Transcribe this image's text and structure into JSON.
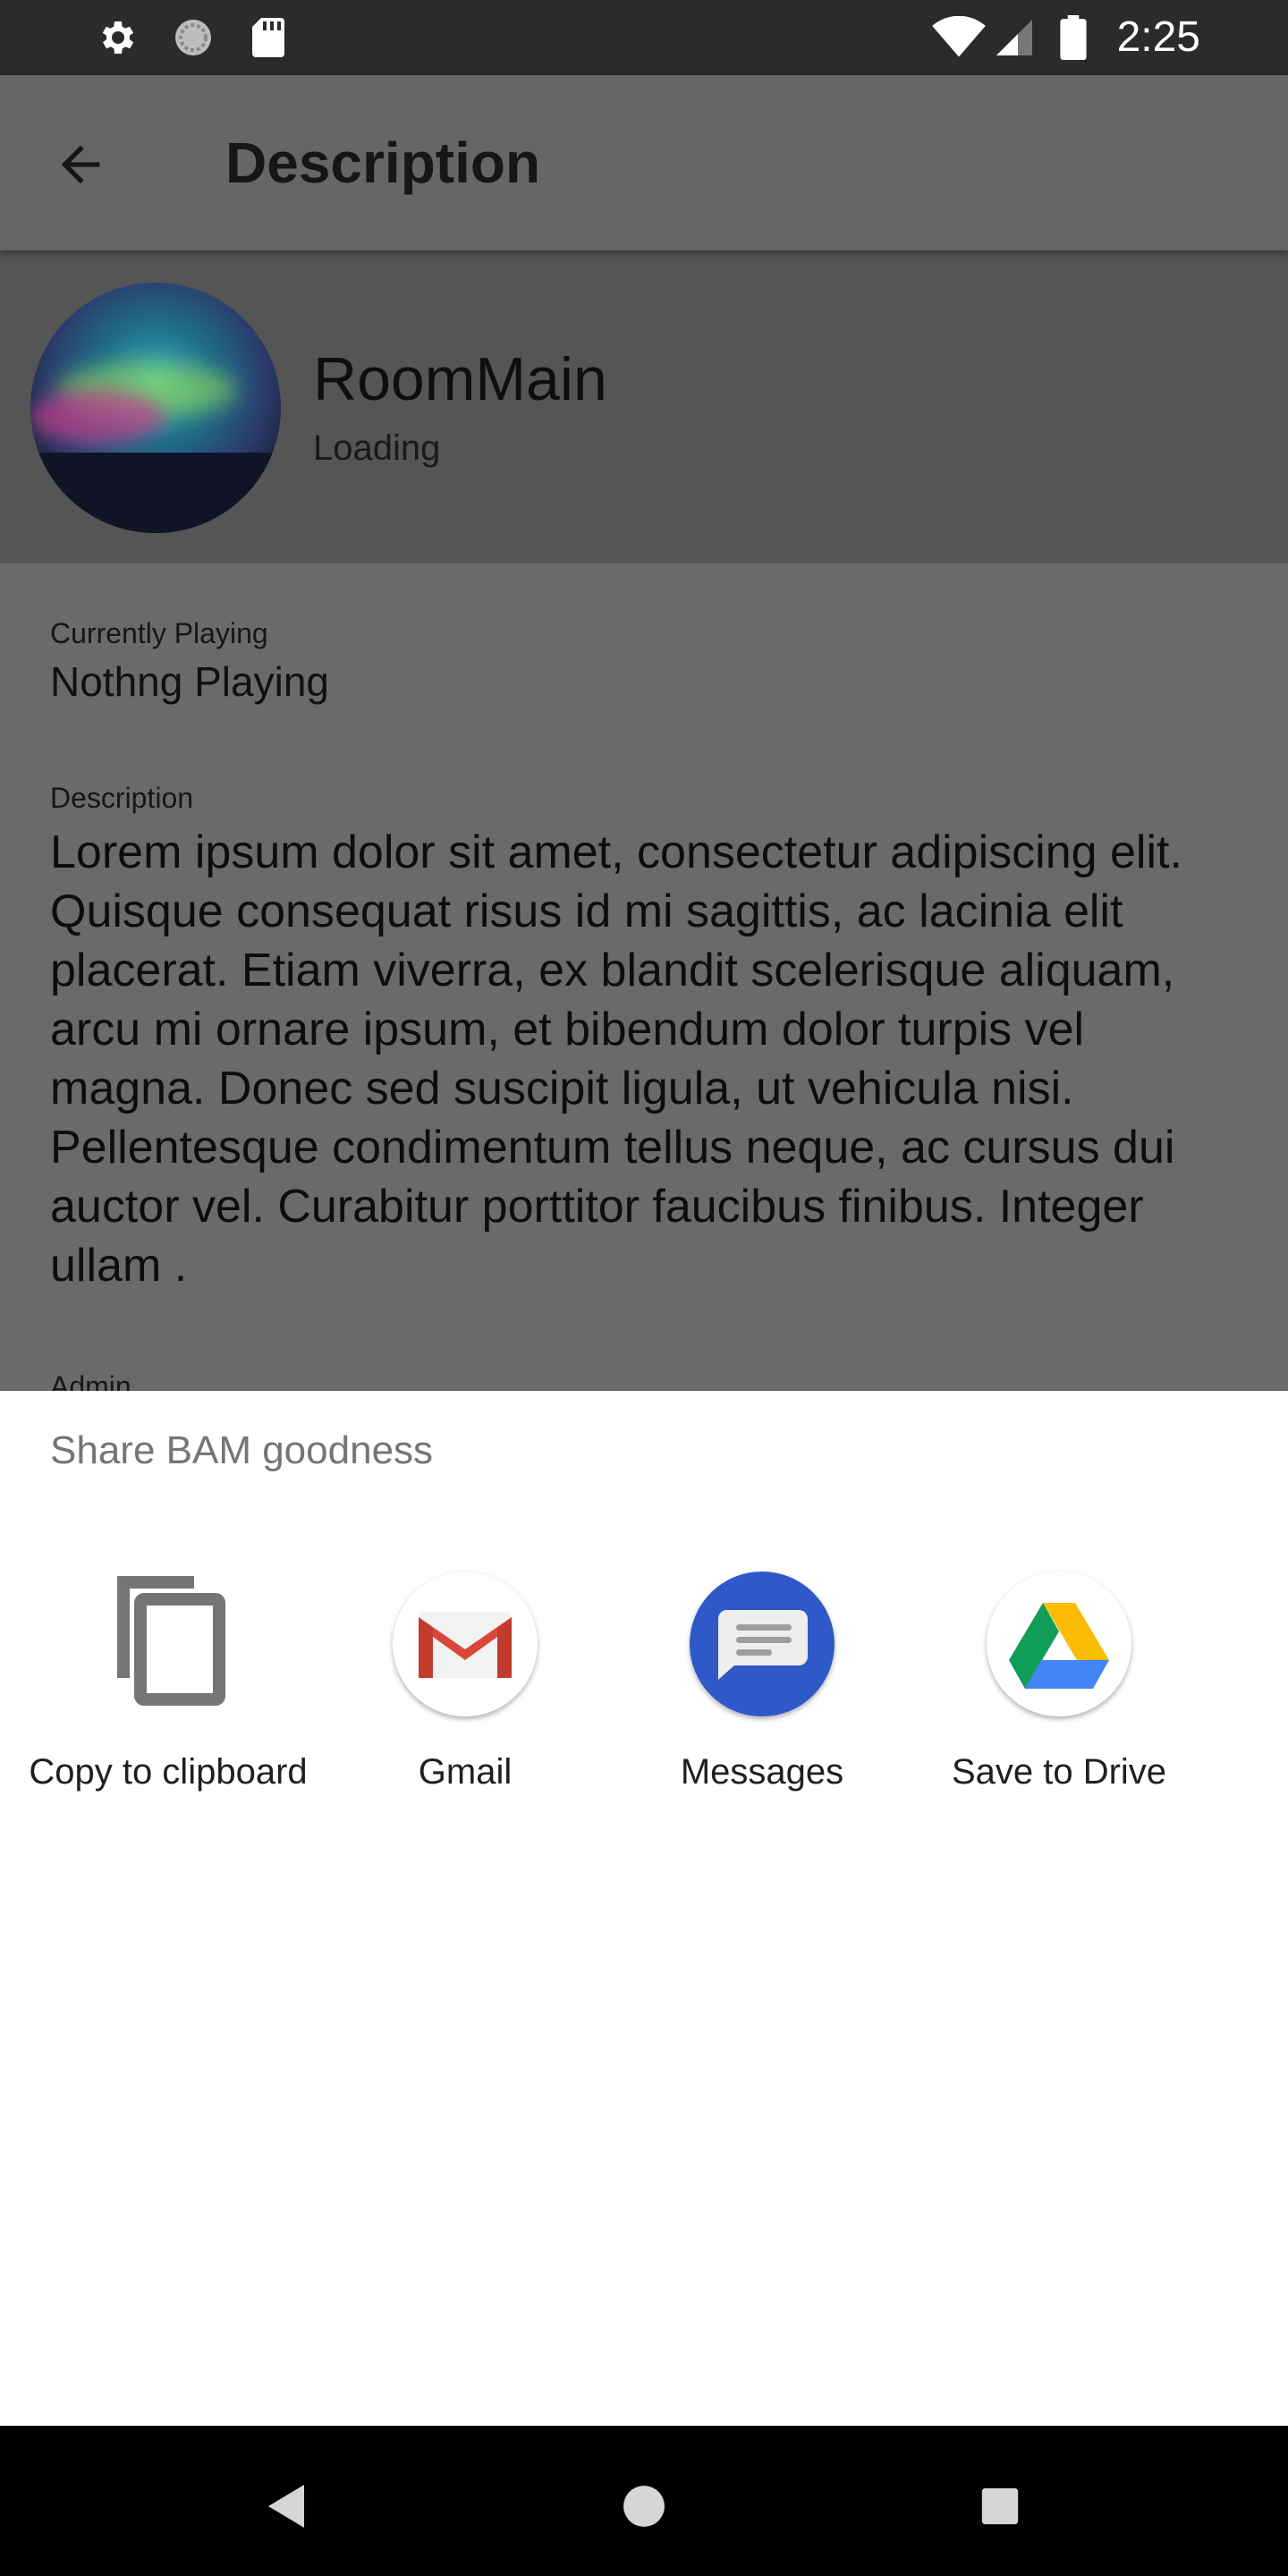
{
  "status_bar": {
    "time": "2:25",
    "icons": [
      "gear-icon",
      "sync-icon",
      "sd-card-icon",
      "wifi-icon",
      "signal-icon",
      "battery-icon"
    ]
  },
  "app_bar": {
    "title": "Description",
    "back_icon": "arrow-back-icon"
  },
  "room": {
    "name": "RoomMain",
    "status": "Loading"
  },
  "details": {
    "currently_playing_label": "Currently Playing",
    "currently_playing_value": "Nothng Playing",
    "description_label": "Description",
    "description_text": "Lorem ipsum dolor sit amet, consectetur adipiscing elit. Quisque consequat risus id mi sagittis, ac lacinia elit placerat. Etiam viverra, ex blandit scelerisque aliquam, arcu mi ornare ipsum, et bibendum dolor turpis vel magna. Donec sed suscipit ligula, ut vehicula nisi. Pellentesque condimentum tellus neque, ac cursus dui auctor vel. Curabitur porttitor faucibus finibus. Integer ullam .",
    "admin_label": "Admin"
  },
  "share_sheet": {
    "title": "Share BAM goodness",
    "targets": [
      {
        "label": "Copy to clipboard",
        "icon": "copy-icon"
      },
      {
        "label": "Gmail",
        "icon": "gmail-icon"
      },
      {
        "label": "Messages",
        "icon": "messages-icon"
      },
      {
        "label": "Save to Drive",
        "icon": "drive-icon"
      }
    ]
  },
  "nav_bar": {
    "buttons": [
      "back-triangle-icon",
      "home-circle-icon",
      "recents-square-icon"
    ]
  },
  "colors": {
    "scrim_gray": "#666666",
    "messages_blue": "#2f58c9",
    "gmail_red": "#d9473a"
  }
}
